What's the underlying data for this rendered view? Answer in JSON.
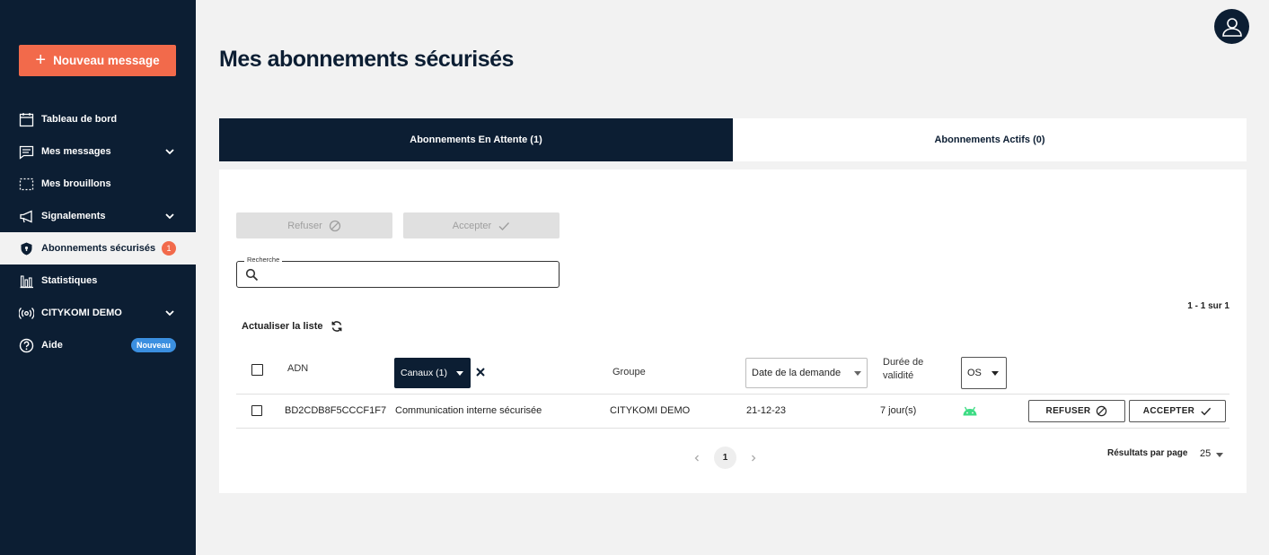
{
  "sidebar": {
    "new_message_label": "Nouveau message",
    "items": [
      {
        "label": "Tableau de bord",
        "icon": "calendar-icon"
      },
      {
        "label": "Mes messages",
        "icon": "message-icon"
      },
      {
        "label": "Mes brouillons",
        "icon": "draft-icon"
      },
      {
        "label": "Signalements",
        "icon": "megaphone-icon"
      },
      {
        "label": "Abonnements sécurisés",
        "icon": "shield-icon",
        "badge": "1",
        "active": true
      },
      {
        "label": "Statistiques",
        "icon": "chart-icon"
      },
      {
        "label": "CITYKOMI DEMO",
        "icon": "broadcast-icon"
      },
      {
        "label": "Aide",
        "icon": "help-icon",
        "badge": "Nouveau"
      }
    ]
  },
  "page_title": "Mes abonnements sécurisés",
  "tabs": [
    {
      "label": "Abonnements En Attente (1)",
      "active": true
    },
    {
      "label": "Abonnements Actifs (0)",
      "active": false
    }
  ],
  "actions": {
    "refuse_label": "Refuser",
    "accept_label": "Accepter"
  },
  "search": {
    "legend": "Recherche",
    "value": ""
  },
  "range_info": "1 - 1 sur 1",
  "refresh_label": "Actualiser la liste",
  "table": {
    "headers": {
      "adn": "ADN",
      "canaux": "Canaux (1)",
      "groupe": "Groupe",
      "date": "Date de la demande",
      "duree_line1": "Durée de",
      "duree_line2": "validité",
      "os": "OS"
    },
    "rows": [
      {
        "adn": "BD2CDB8F5CCCF1F7",
        "canal": "Communication interne sécurisée",
        "groupe": "CITYKOMI DEMO",
        "date": "21-12-23",
        "duree": "7 jour(s)",
        "os_icon": "android-icon",
        "refuse_label": "REFUSER",
        "accept_label": "ACCEPTER"
      }
    ]
  },
  "pagination": {
    "current_page": "1",
    "per_page_label": "Résultats par page",
    "per_page_value": "25"
  },
  "colors": {
    "navy": "#0c1e33",
    "accent": "#f26a4b",
    "blue_badge": "#3b8fe0",
    "android_green": "#3ddc84"
  }
}
